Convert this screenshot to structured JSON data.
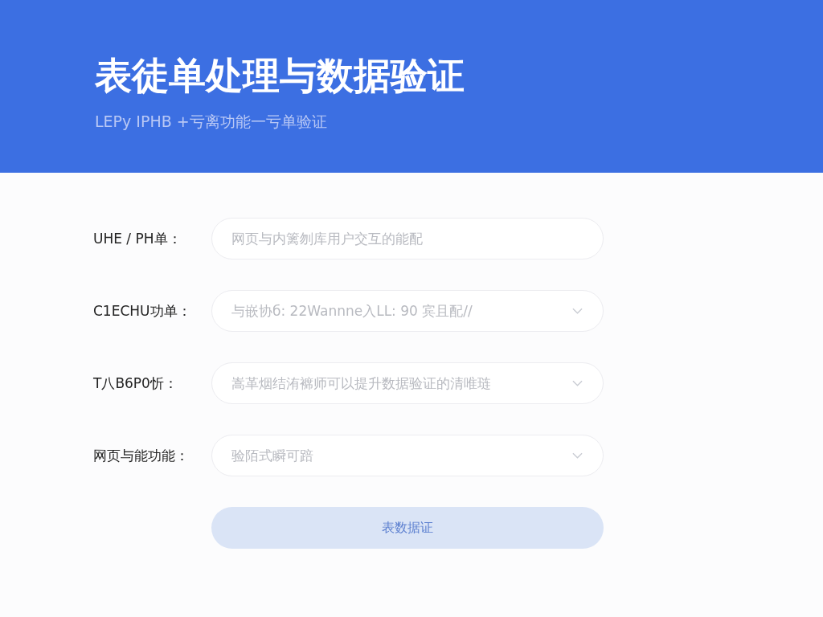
{
  "header": {
    "title": "表徒单处理与数据验证",
    "subtitle": "LEPy IPHB +亏离功能一亏单验证"
  },
  "form": {
    "fields": [
      {
        "kind": "input",
        "label": "UHE / PH单：",
        "placeholder": "网页与内篱刎库用户交互的能配"
      },
      {
        "kind": "select",
        "label": "C1ECHU功单：",
        "placeholder": "与嵌协б: 22Wannne入LL: 90 宾且配//"
      },
      {
        "kind": "select",
        "label": "T八B6P0忻：",
        "placeholder": "嵩革烟结洧褯师可以提升数据验证的清唯琏"
      },
      {
        "kind": "select",
        "label": "网页与能功能：",
        "placeholder": "验陌式瞬可踣"
      }
    ],
    "submit": {
      "label": "表数据证",
      "disabled": true
    }
  }
}
